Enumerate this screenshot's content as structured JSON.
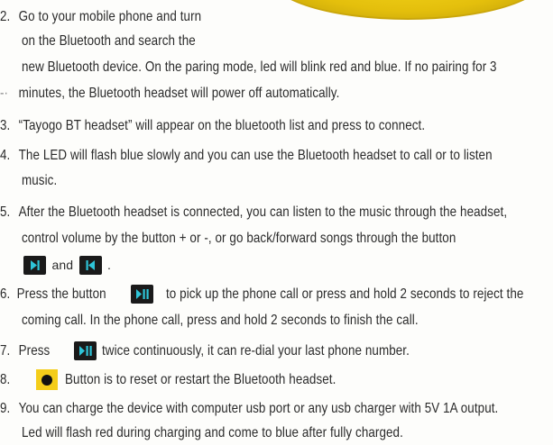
{
  "items": [
    {
      "num": "2.",
      "lines": [
        "Go to your mobile phone and turn",
        "on the Bluetooth and search the",
        "new Bluetooth device. On the paring mode, led will blink red and blue. If no pairing for 3",
        "minutes, the Bluetooth headset will power off automatically."
      ]
    },
    {
      "num": "3.",
      "lines": [
        "“Tayogo BT headset” will appear on the bluetooth list and press to connect."
      ]
    },
    {
      "num": "4.",
      "lines": [
        "The LED will flash blue slowly and you can use the Bluetooth headset to call or to listen",
        "music."
      ]
    },
    {
      "num": "5.",
      "lines": [
        "After the Bluetooth headset is connected, you can listen to the music through the headset,",
        "control volume by the button + or -, or go back/forward songs through the button",
        "and",
        "."
      ]
    },
    {
      "num": "6.",
      "lines": [
        "Press the button",
        "to pick up the phone call or press and hold 2 seconds to reject the",
        "coming call. In the phone call, press and hold 2 seconds to finish the call."
      ]
    },
    {
      "num": "7.",
      "lines": [
        "Press",
        "twice continuously, it can re-dial your last phone number."
      ]
    },
    {
      "num": "8.",
      "lines": [
        "Button is to reset or restart the Bluetooth headset."
      ]
    },
    {
      "num": "9.",
      "lines": [
        "You can charge the device with computer usb port or any usb charger with 5V 1A output.",
        "Led will flash red during charging and come to blue after fully charged."
      ]
    }
  ],
  "icons": {
    "play_pause": "play-pause-icon",
    "next": "skip-forward-icon",
    "prev": "skip-back-icon",
    "reset": "reset-button-icon"
  },
  "colors": {
    "button_bg": "#1a1a1a",
    "button_glyph": "#2ec4d8",
    "reset_bg": "#f4cd1a",
    "deco": "#e4bf0c"
  }
}
